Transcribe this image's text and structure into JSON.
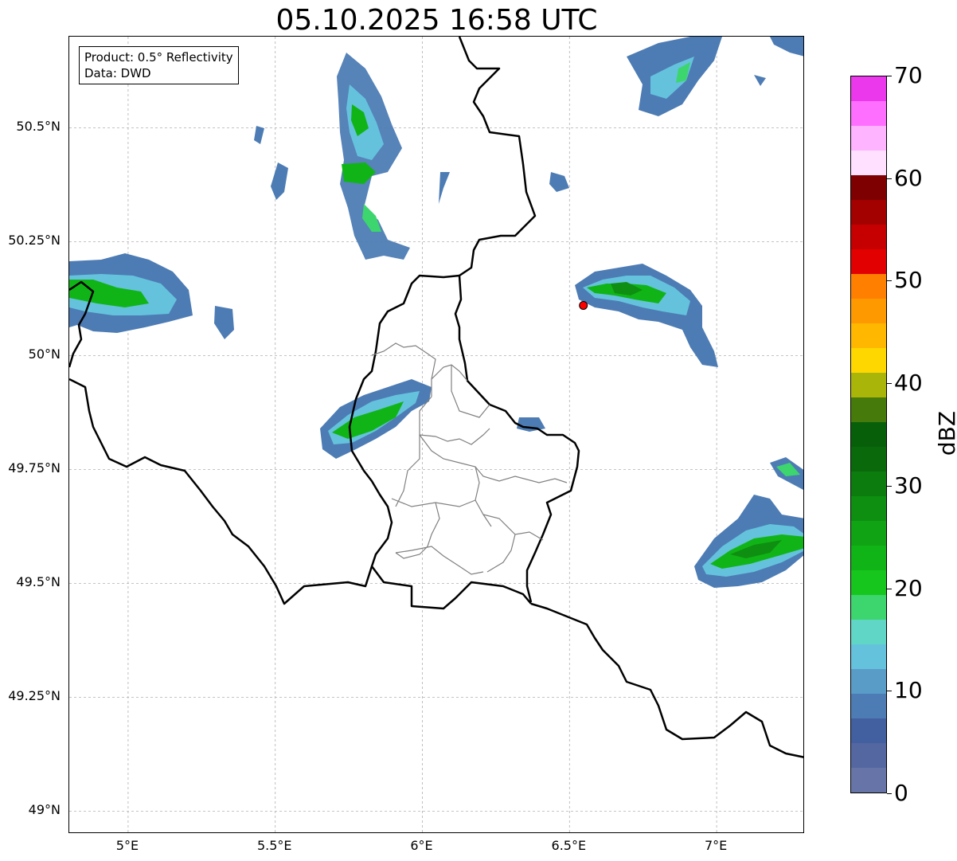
{
  "title": "05.10.2025 16:58 UTC",
  "info_box": {
    "product": "Product: 0.5° Reflectivity",
    "data": "Data: DWD"
  },
  "map": {
    "lon_range": [
      4.8,
      7.3
    ],
    "lat_range": [
      48.95,
      50.7
    ],
    "lat_ticks": [
      {
        "value": 49.0,
        "label": "49°N"
      },
      {
        "value": 49.25,
        "label": "49.25°N"
      },
      {
        "value": 49.5,
        "label": "49.5°N"
      },
      {
        "value": 49.75,
        "label": "49.75°N"
      },
      {
        "value": 50.0,
        "label": "50°N"
      },
      {
        "value": 50.25,
        "label": "50.25°N"
      },
      {
        "value": 50.5,
        "label": "50.5°N"
      }
    ],
    "lon_ticks": [
      {
        "value": 5.0,
        "label": "5°E"
      },
      {
        "value": 5.5,
        "label": "5.5°E"
      },
      {
        "value": 6.0,
        "label": "6°E"
      },
      {
        "value": 6.5,
        "label": "6.5°E"
      },
      {
        "value": 7.0,
        "label": "7°E"
      }
    ],
    "radar_site": {
      "lon": 6.547,
      "lat": 50.11,
      "color": "#ff0000"
    },
    "gridline_color": "#b0b0b0",
    "border_color": "#000000",
    "district_color": "#808080"
  },
  "colorbar": {
    "unit": "dBZ",
    "min": 0,
    "max": 70,
    "step": 2.5,
    "colors": [
      "#6674a8",
      "#5467a0",
      "#425fa0",
      "#4d7cb4",
      "#5a9cc8",
      "#65c2dd",
      "#5fd6c6",
      "#3dd56e",
      "#16c61c",
      "#11b416",
      "#10a313",
      "#0e8f11",
      "#0b7c0d",
      "#0a6a0b",
      "#076009",
      "#467a0a",
      "#aab50a",
      "#ffd700",
      "#ffb700",
      "#ff9900",
      "#ff7f00",
      "#e20000",
      "#c60000",
      "#a30000",
      "#7e0000",
      "#ffe1ff",
      "#ffb4ff",
      "#ff6fff",
      "#ec38ec"
    ],
    "tick_labels": [
      {
        "value": 0,
        "label": "0"
      },
      {
        "value": 10,
        "label": "10"
      },
      {
        "value": 20,
        "label": "20"
      },
      {
        "value": 30,
        "label": "30"
      },
      {
        "value": 40,
        "label": "40"
      },
      {
        "value": 50,
        "label": "50"
      },
      {
        "value": 60,
        "label": "60"
      },
      {
        "value": 70,
        "label": "70"
      }
    ]
  },
  "echo_cells": [
    {
      "name": "north-central-band",
      "lon": 5.8,
      "lat": 50.5,
      "dbz_peak": 25
    },
    {
      "name": "west-edge-cell",
      "lon": 4.98,
      "lat": 50.14,
      "dbz_peak": 25
    },
    {
      "name": "central-cell",
      "lon": 5.85,
      "lat": 49.85,
      "dbz_peak": 27
    },
    {
      "name": "east-central-cell",
      "lon": 6.75,
      "lat": 50.14,
      "dbz_peak": 28
    },
    {
      "name": "southeast-cell",
      "lon": 7.1,
      "lat": 49.6,
      "dbz_peak": 27
    },
    {
      "name": "northeast-cell",
      "lon": 6.9,
      "lat": 50.6,
      "dbz_peak": 20
    }
  ]
}
